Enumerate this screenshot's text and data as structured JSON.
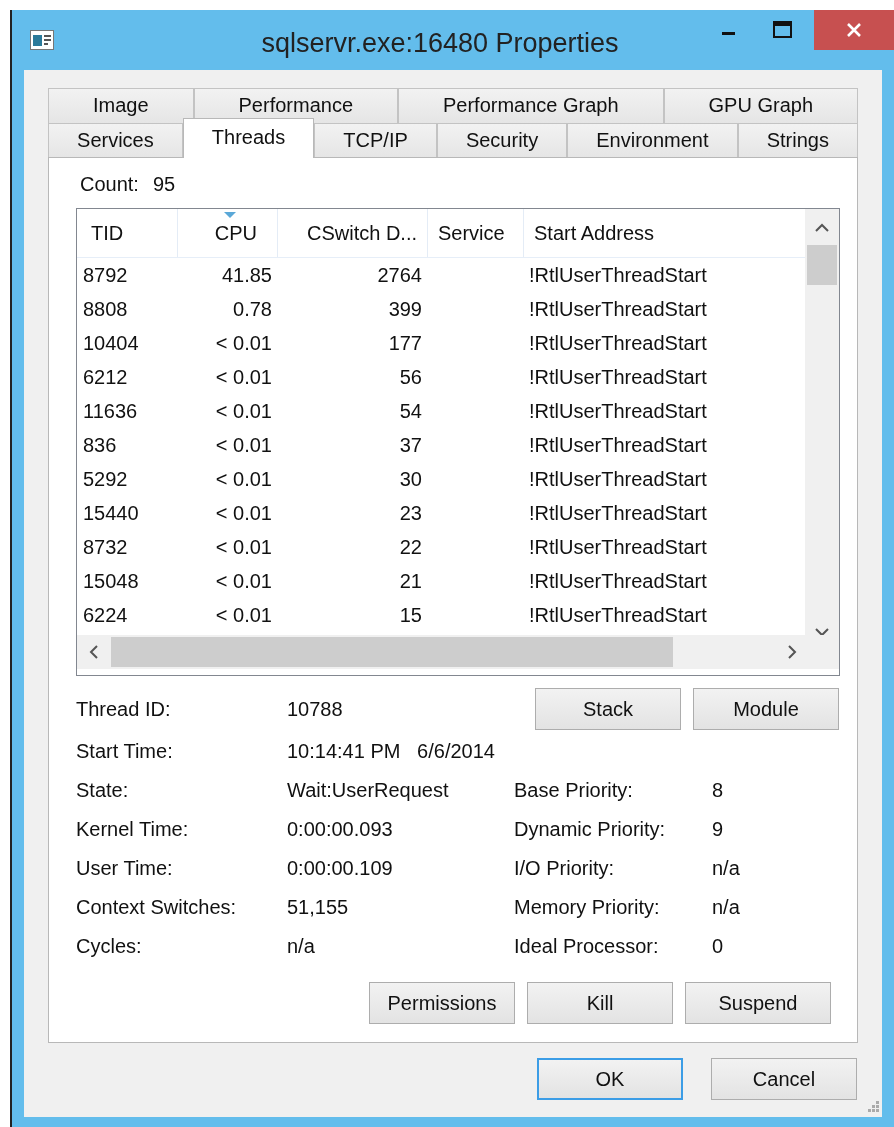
{
  "window": {
    "title": "sqlservr.exe:16480 Properties"
  },
  "tab_rows": [
    [
      {
        "label": "Image",
        "selected": false
      },
      {
        "label": "Performance",
        "selected": false
      },
      {
        "label": "Performance Graph",
        "selected": false
      },
      {
        "label": "GPU Graph",
        "selected": false
      }
    ],
    [
      {
        "label": "Services",
        "selected": false
      },
      {
        "label": "Threads",
        "selected": true
      },
      {
        "label": "TCP/IP",
        "selected": false
      },
      {
        "label": "Security",
        "selected": false
      },
      {
        "label": "Environment",
        "selected": false
      },
      {
        "label": "Strings",
        "selected": false
      }
    ]
  ],
  "count": {
    "label": "Count:",
    "value": "95"
  },
  "table": {
    "columns": [
      {
        "label": "TID",
        "sorted": false
      },
      {
        "label": "CPU",
        "sorted": true
      },
      {
        "label": "CSwitch D...",
        "sorted": false
      },
      {
        "label": "Service",
        "sorted": false
      },
      {
        "label": "Start Address",
        "sorted": false
      }
    ],
    "rows": [
      [
        "8792",
        "41.85",
        "2764",
        "",
        "!RtlUserThreadStart"
      ],
      [
        "8808",
        "0.78",
        "399",
        "",
        "!RtlUserThreadStart"
      ],
      [
        "10404",
        "< 0.01",
        "177",
        "",
        "!RtlUserThreadStart"
      ],
      [
        "6212",
        "< 0.01",
        "56",
        "",
        "!RtlUserThreadStart"
      ],
      [
        "11636",
        "< 0.01",
        "54",
        "",
        "!RtlUserThreadStart"
      ],
      [
        "836",
        "< 0.01",
        "37",
        "",
        "!RtlUserThreadStart"
      ],
      [
        "5292",
        "< 0.01",
        "30",
        "",
        "!RtlUserThreadStart"
      ],
      [
        "15440",
        "< 0.01",
        "23",
        "",
        "!RtlUserThreadStart"
      ],
      [
        "8732",
        "< 0.01",
        "22",
        "",
        "!RtlUserThreadStart"
      ],
      [
        "15048",
        "< 0.01",
        "21",
        "",
        "!RtlUserThreadStart"
      ],
      [
        "6224",
        "< 0.01",
        "15",
        "",
        "!RtlUserThreadStart"
      ]
    ]
  },
  "thread_id": {
    "label": "Thread ID:",
    "value": "10788"
  },
  "thread_buttons": [
    "Stack",
    "Module"
  ],
  "start_time": {
    "label": "Start Time:",
    "value": "10:14:41 PM   6/6/2014"
  },
  "details": [
    {
      "left": {
        "label": "State:",
        "value": "Wait:UserRequest"
      },
      "right": {
        "label": "Base Priority:",
        "value": "8"
      }
    },
    {
      "left": {
        "label": "Kernel Time:",
        "value": "0:00:00.093"
      },
      "right": {
        "label": "Dynamic Priority:",
        "value": "9"
      }
    },
    {
      "left": {
        "label": "User Time:",
        "value": "0:00:00.109"
      },
      "right": {
        "label": "I/O Priority:",
        "value": "n/a"
      }
    },
    {
      "left": {
        "label": "Context Switches:",
        "value": "51,155"
      },
      "right": {
        "label": "Memory Priority:",
        "value": "n/a"
      }
    },
    {
      "left": {
        "label": "Cycles:",
        "value": "n/a"
      },
      "right": {
        "label": "Ideal Processor:",
        "value": "0"
      }
    }
  ],
  "actions": [
    "Permissions",
    "Kill",
    "Suspend"
  ],
  "dialog_buttons": [
    {
      "label": "OK",
      "default": true
    },
    {
      "label": "Cancel",
      "default": false
    }
  ]
}
